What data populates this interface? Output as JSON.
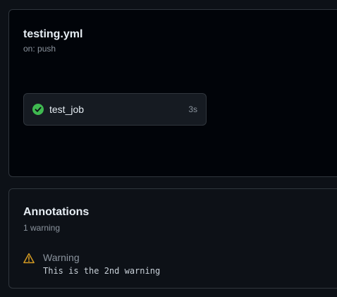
{
  "workflow": {
    "title": "testing.yml",
    "trigger": "on: push",
    "job": {
      "name": "test_job",
      "duration": "3s",
      "status": "success",
      "status_icon": "check-circle-icon",
      "status_color": "#3fb950"
    }
  },
  "annotations": {
    "title": "Annotations",
    "count_label": "1 warning",
    "items": [
      {
        "level": "Warning",
        "message": "This is the 2nd warning",
        "icon": "warning-triangle-icon",
        "icon_color": "#d29922"
      }
    ]
  },
  "colors": {
    "background": "#0d1117",
    "card_background": "#010409",
    "border": "#30363d",
    "text_primary": "#e6edf3",
    "text_muted": "#8b949e"
  }
}
